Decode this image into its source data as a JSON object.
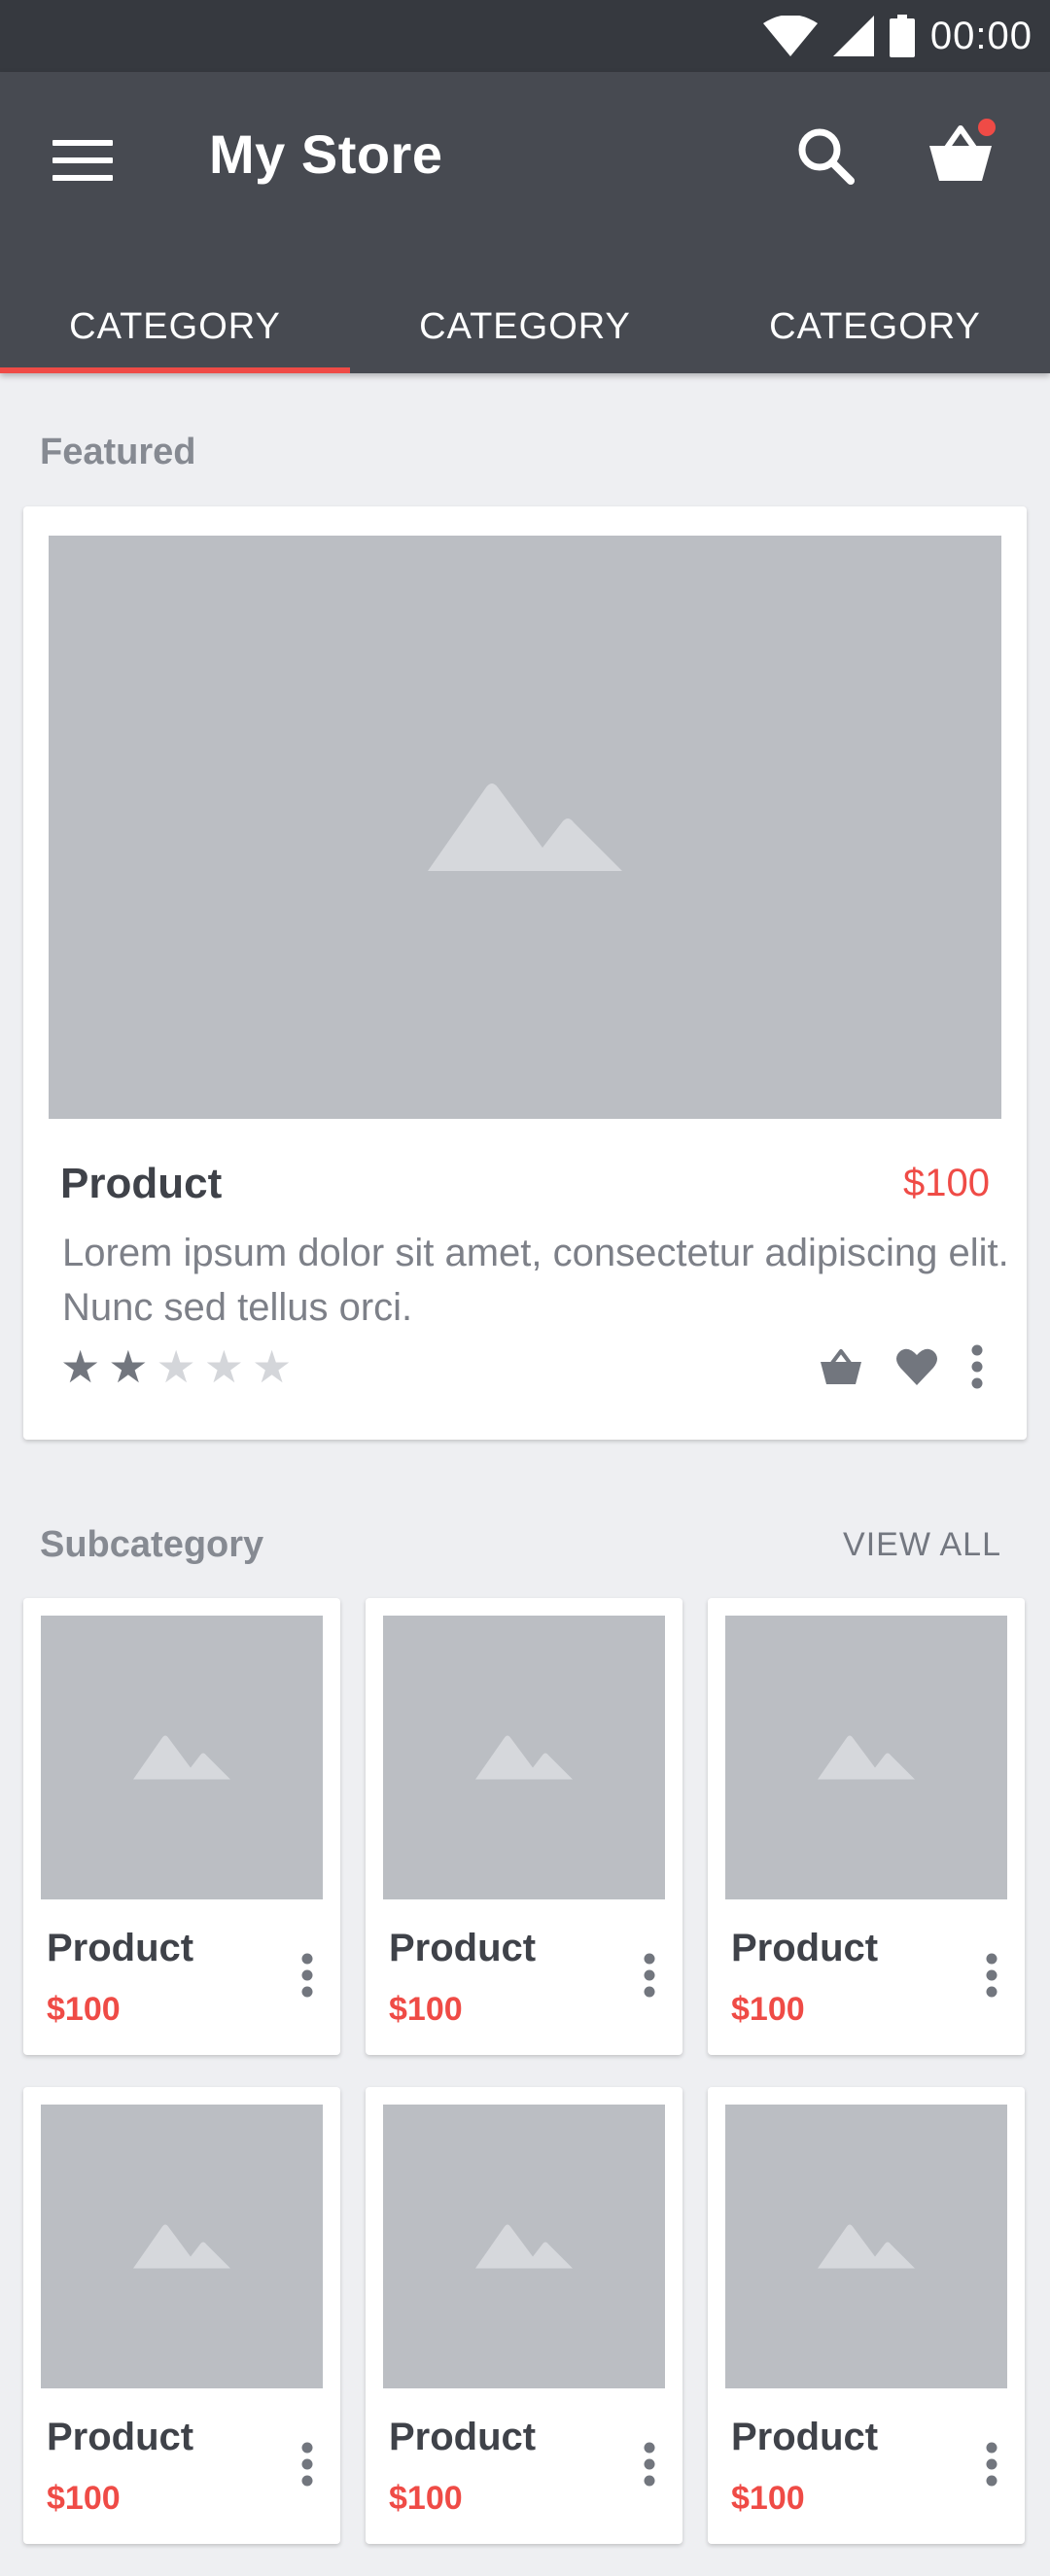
{
  "status_bar": {
    "time": "00:00"
  },
  "app_bar": {
    "title": "My Store",
    "tabs": [
      {
        "label": "CATEGORY",
        "active": true
      },
      {
        "label": "CATEGORY",
        "active": false
      },
      {
        "label": "CATEGORY",
        "active": false
      }
    ]
  },
  "featured": {
    "section_title": "Featured",
    "product": {
      "name": "Product",
      "price": "$100",
      "description": "Lorem ipsum dolor sit amet, consectetur adipiscing elit. Nunc sed tellus orci.",
      "rating": 2,
      "rating_max": 5
    }
  },
  "subcategory": {
    "section_title": "Subcategory",
    "view_all": "VIEW ALL",
    "products": [
      {
        "name": "Product",
        "price": "$100"
      },
      {
        "name": "Product",
        "price": "$100"
      },
      {
        "name": "Product",
        "price": "$100"
      },
      {
        "name": "Product",
        "price": "$100"
      },
      {
        "name": "Product",
        "price": "$100"
      },
      {
        "name": "Product",
        "price": "$100"
      }
    ]
  },
  "colors": {
    "accent": "#ef4b46",
    "app_bar": "#474a51",
    "status_bar": "#36393f",
    "background": "#eeeff2"
  }
}
